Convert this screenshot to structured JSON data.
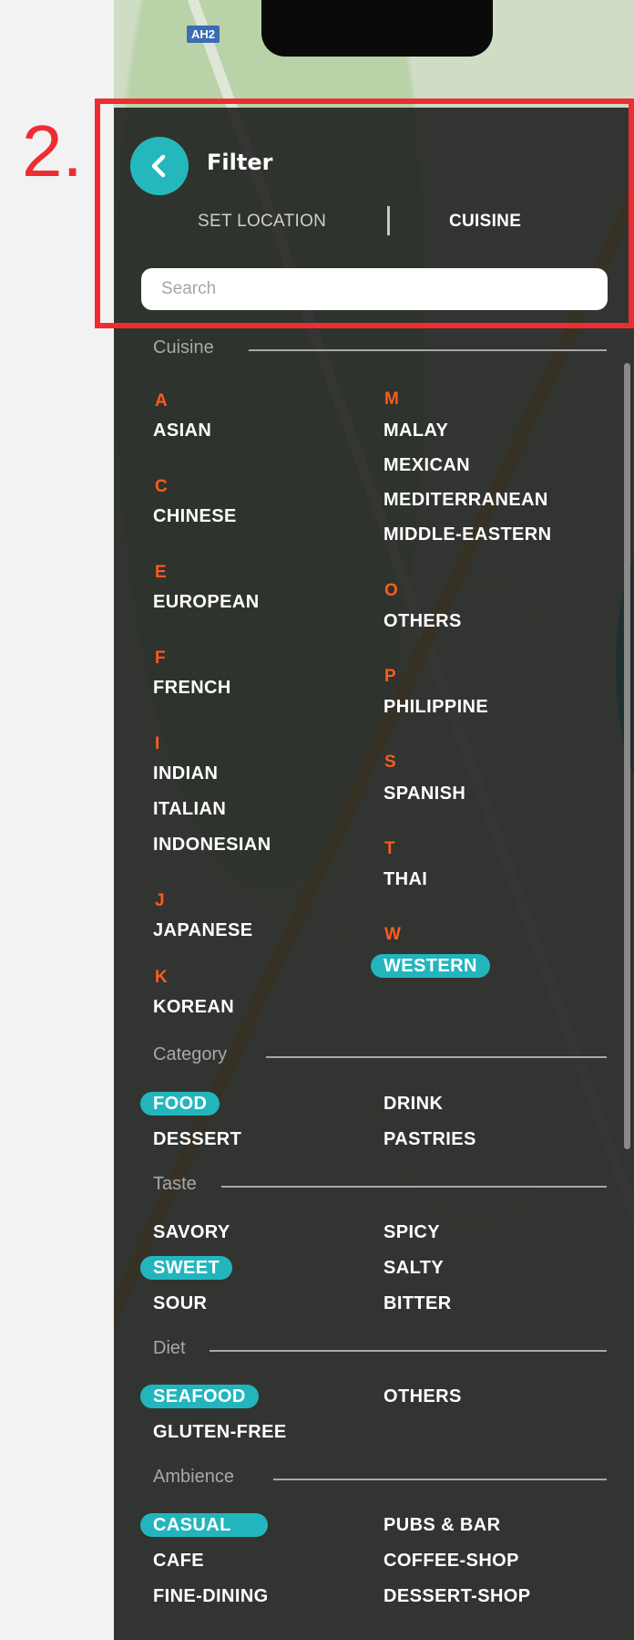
{
  "annotation": {
    "number": "2."
  },
  "map": {
    "badge": "AH2"
  },
  "header": {
    "title": "Filter",
    "tabs": [
      "SET LOCATION",
      "CUISINE"
    ],
    "active_tab": "CUISINE"
  },
  "search": {
    "placeholder": "Search",
    "value": ""
  },
  "colors": {
    "accent": "#22b5bd",
    "letter": "#ff5b1f",
    "annotation": "#ee2d33"
  },
  "cuisine": {
    "title": "Cuisine",
    "letters": [
      "A",
      "C",
      "E",
      "F",
      "I",
      "J",
      "K",
      "M",
      "O",
      "P",
      "S",
      "T",
      "W"
    ],
    "items": [
      "ASIAN",
      "CHINESE",
      "EUROPEAN",
      "FRENCH",
      "INDIAN",
      "ITALIAN",
      "INDONESIAN",
      "JAPANESE",
      "KOREAN",
      "MALAY",
      "MEXICAN",
      "MEDITERRANEAN",
      "MIDDLE-EASTERN",
      "OTHERS",
      "PHILIPPINE",
      "SPANISH",
      "THAI",
      "WESTERN"
    ],
    "selected": [
      "WESTERN"
    ]
  },
  "category": {
    "title": "Category",
    "items": [
      "FOOD",
      "DESSERT",
      "DRINK",
      "PASTRIES"
    ],
    "selected": [
      "FOOD"
    ]
  },
  "taste": {
    "title": "Taste",
    "items": [
      "SAVORY",
      "SWEET",
      "SOUR",
      "SPICY",
      "SALTY",
      "BITTER"
    ],
    "selected": [
      "SWEET"
    ]
  },
  "diet": {
    "title": "Diet",
    "items": [
      "SEAFOOD",
      "GLUTEN-FREE",
      "OTHERS"
    ],
    "selected": [
      "SEAFOOD"
    ]
  },
  "ambience": {
    "title": "Ambience",
    "items": [
      "CASUAL",
      "CAFE",
      "FINE-DINING",
      "PUBS & BAR",
      "COFFEE-SHOP",
      "DESSERT-SHOP"
    ],
    "selected": [
      "CASUAL"
    ]
  }
}
